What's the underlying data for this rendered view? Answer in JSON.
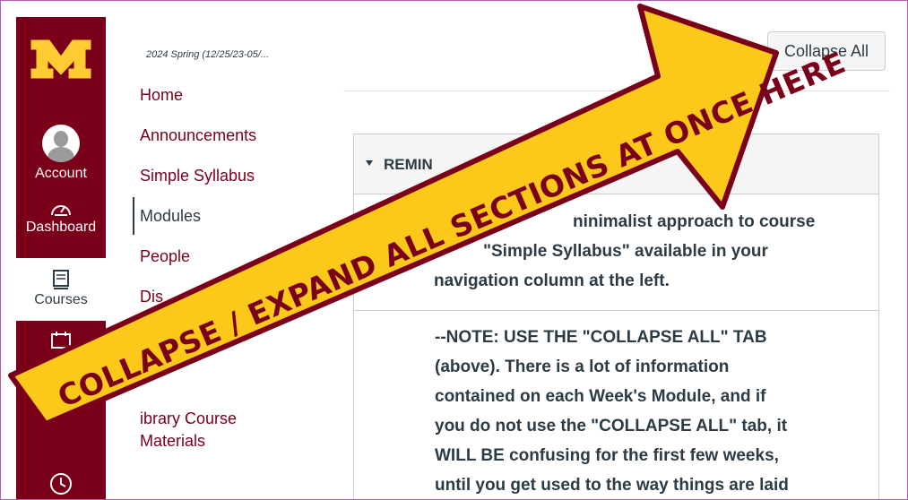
{
  "global_nav": {
    "account_label": "Account",
    "dashboard_label": "Dashboard",
    "courses_label": "Courses",
    "brand_color": "#7a0019",
    "gold_color": "#ffcc33"
  },
  "course": {
    "term": "2024 Spring (12/25/23-05/...",
    "nav": [
      {
        "label": "Home",
        "active": false
      },
      {
        "label": "Announcements",
        "active": false
      },
      {
        "label": "Simple Syllabus",
        "active": false
      },
      {
        "label": "Modules",
        "active": true
      },
      {
        "label": "People",
        "active": false
      },
      {
        "label": "Dis",
        "active": false
      },
      {
        "label": "ibrary Course",
        "active": false
      },
      {
        "label": "Materials",
        "active": false
      }
    ]
  },
  "toolbar": {
    "collapse_all_label": "Collapse All"
  },
  "module": {
    "title": "REMIN",
    "item1": {
      "line1": "ninimalist approach to course",
      "line2": "\"Simple Syllabus\" available in your",
      "line3": "navigation column at the left."
    },
    "note": {
      "line1": "--NOTE: USE THE \"COLLAPSE ALL\" TAB",
      "line2": "(above). There is a lot of information",
      "line3": "contained on each Week's Module, and if",
      "line4": "you do not use the \"COLLAPSE ALL\" tab, it",
      "line5": "WILL BE confusing for the first few weeks,",
      "line6": "until you get used to the way things are laid"
    }
  },
  "annotation": {
    "text": "COLLAPSE / EXPAND ALL SECTIONS AT ONCE HERE",
    "fill_color": "#fcc81a",
    "stroke_color": "#7a0019"
  }
}
